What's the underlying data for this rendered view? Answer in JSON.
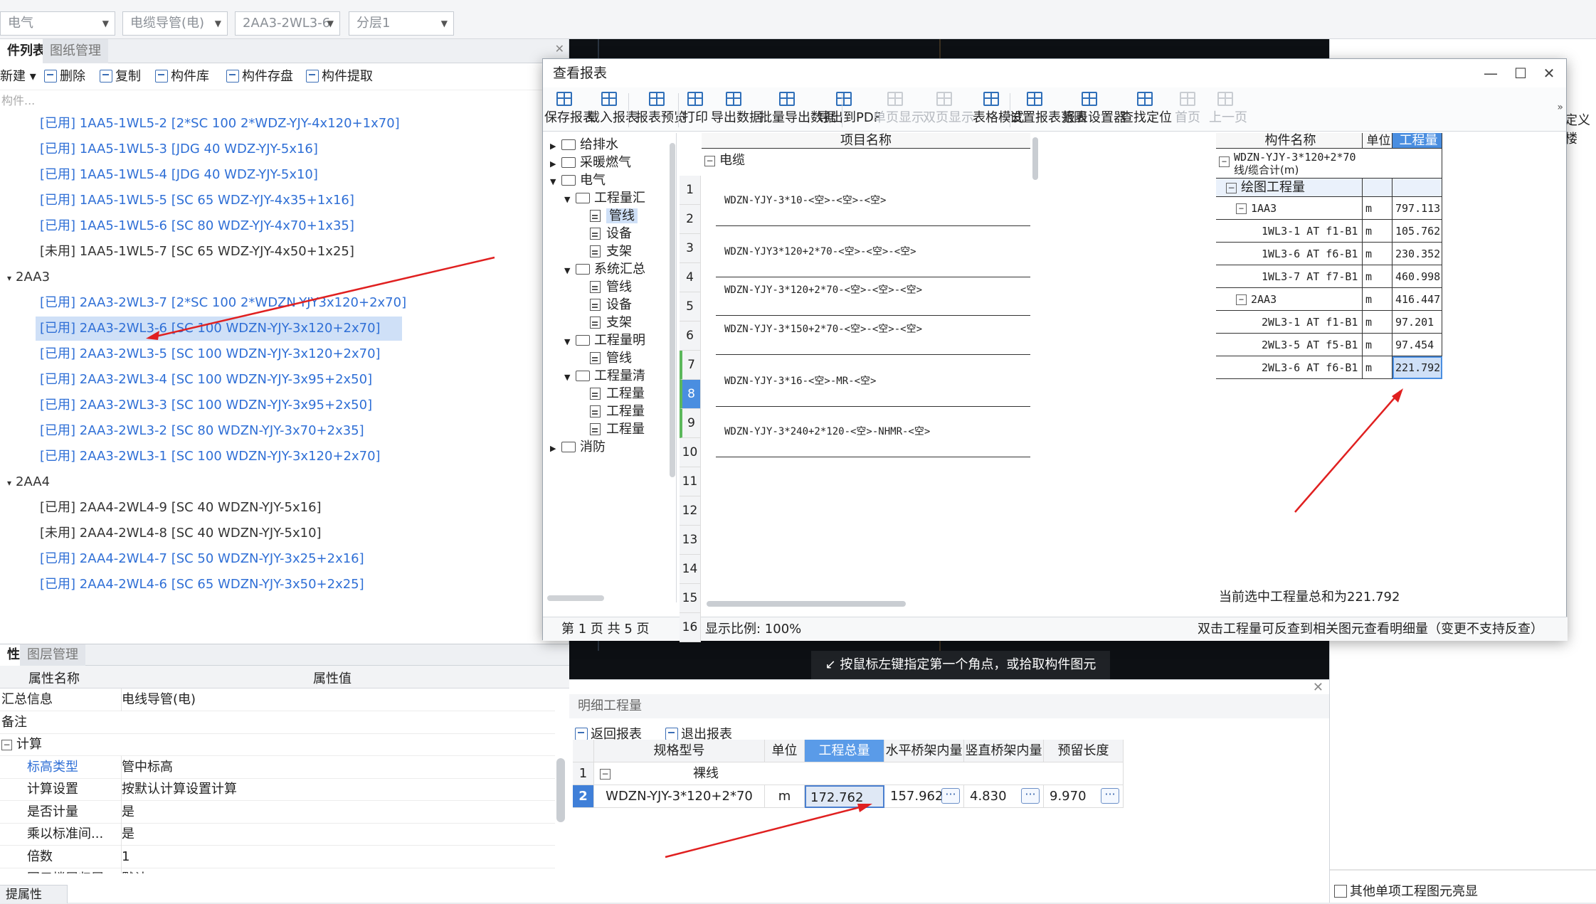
{
  "top_bar": {
    "combos": [
      "电气",
      "电缆导管(电)",
      "2AA3-2WL3-6",
      "分层1"
    ]
  },
  "left_panel": {
    "tabs": [
      "件列表",
      "图纸管理"
    ],
    "toolbar": [
      "新建",
      "删除",
      "复制",
      "构件库",
      "构件存盘",
      "构件提取"
    ],
    "filter_placeholder": "构件...",
    "items": [
      {
        "text": "[已用] 1AA5-1WL5-2 [2*SC 100 2*WDZ-YJY-4x120+1x70]",
        "type": "used"
      },
      {
        "text": "[已用] 1AA5-1WL5-3 [JDG 40 WDZ-YJY-5x16]",
        "type": "used"
      },
      {
        "text": "[已用] 1AA5-1WL5-4 [JDG 40 WDZ-YJY-5x10]",
        "type": "used"
      },
      {
        "text": "[已用] 1AA5-1WL5-5 [SC 65 WDZ-YJY-4x35+1x16]",
        "type": "used"
      },
      {
        "text": "[已用] 1AA5-1WL5-6 [SC 80 WDZ-YJY-4x70+1x35]",
        "type": "used"
      },
      {
        "text": "[未用] 1AA5-1WL5-7 [SC 65 WDZ-YJY-4x50+1x25]",
        "type": "unused"
      },
      {
        "text": "2AA3",
        "type": "group"
      },
      {
        "text": "[已用] 2AA3-2WL3-7 [2*SC 100 2*WDZN-YJY3x120+2x70]",
        "type": "used"
      },
      {
        "text": "[已用] 2AA3-2WL3-6 [SC 100 WDZN-YJY-3x120+2x70]",
        "type": "used-selected"
      },
      {
        "text": "[已用] 2AA3-2WL3-5 [SC 100 WDZN-YJY-3x120+2x70]",
        "type": "used"
      },
      {
        "text": "[已用] 2AA3-2WL3-4 [SC 100 WDZN-YJY-3x95+2x50]",
        "type": "used"
      },
      {
        "text": "[已用] 2AA3-2WL3-3 [SC 100 WDZN-YJY-3x95+2x50]",
        "type": "used"
      },
      {
        "text": "[已用] 2AA3-2WL3-2 [SC 80 WDZN-YJY-3x70+2x35]",
        "type": "used"
      },
      {
        "text": "[已用] 2AA3-2WL3-1 [SC 100 WDZN-YJY-3x120+2x70]",
        "type": "used"
      },
      {
        "text": "2AA4",
        "type": "group"
      },
      {
        "text": "[已用] 2AA4-2WL4-9 [SC 40 WDZN-YJY-5x16]",
        "type": "unused"
      },
      {
        "text": "[未用] 2AA4-2WL4-8 [SC 40 WDZN-YJY-5x10]",
        "type": "unused"
      },
      {
        "text": "[已用] 2AA4-2WL4-7 [SC 50 WDZN-YJY-3x25+2x16]",
        "type": "used"
      },
      {
        "text": "[已用] 2AA4-2WL4-6 [SC 65 WDZN-YJY-3x50+2x25]",
        "type": "used"
      }
    ]
  },
  "prop_panel": {
    "tabs": [
      "性",
      "图层管理"
    ],
    "headers": [
      "属性名称",
      "属性值"
    ],
    "rows": [
      {
        "k": "汇总信息",
        "v": "电线导管(电)"
      },
      {
        "k": "备注",
        "v": ""
      },
      {
        "k": "计算",
        "v": ""
      },
      {
        "k": "标高类型",
        "v": "管中标高"
      },
      {
        "k": "计算设置",
        "v": "按默认计算设置计算"
      },
      {
        "k": "是否计量",
        "v": "是"
      },
      {
        "k": "乘以标准间...",
        "v": "是"
      },
      {
        "k": "倍数",
        "v": "1"
      },
      {
        "k": "图元楼层归属",
        "v": "默认"
      }
    ],
    "bottom_tab": "提属性"
  },
  "cad": {
    "prompt": "按鼠标左键指定第一个角点，或拾取构件图元"
  },
  "detail": {
    "title": "明细工程量",
    "buttons": [
      "返回报表",
      "退出报表"
    ],
    "headers": [
      "规格型号",
      "单位",
      "工程总量",
      "水平桥架内量",
      "竖直桥架内量",
      "预留长度"
    ],
    "row1_label": "裸线",
    "row2": {
      "spec": "WDZN-YJY-3*120+2*70",
      "unit": "m",
      "total": "172.762",
      "h": "157.962",
      "v": "4.830",
      "r": "9.970"
    }
  },
  "right_panel": {
    "checkbox_label": "其他单项工程图元亮显",
    "edge_label": "定义楼"
  },
  "dialog": {
    "title": "查看报表",
    "ribbon": [
      "保存报表",
      "载入报表",
      "报表预览",
      "打印",
      "导出数据",
      "批量导出数据",
      "导出到PDF",
      "单页显示",
      "双页显示",
      "表格模式",
      "设置报表范围",
      "报表设置器",
      "查找定位",
      "首页",
      "上一页"
    ],
    "tree": [
      {
        "t": "给排水",
        "lvl": 0,
        "kind": "folder",
        "exp": "closed"
      },
      {
        "t": "采暖燃气",
        "lvl": 0,
        "kind": "folder",
        "exp": "closed"
      },
      {
        "t": "电气",
        "lvl": 0,
        "kind": "folder",
        "exp": "open"
      },
      {
        "t": "工程量汇",
        "lvl": 1,
        "kind": "folder",
        "exp": "open"
      },
      {
        "t": "管线",
        "lvl": 2,
        "kind": "doc",
        "sel": true
      },
      {
        "t": "设备",
        "lvl": 2,
        "kind": "doc"
      },
      {
        "t": "支架",
        "lvl": 2,
        "kind": "doc"
      },
      {
        "t": "系统汇总",
        "lvl": 1,
        "kind": "folder",
        "exp": "open"
      },
      {
        "t": "管线",
        "lvl": 2,
        "kind": "doc"
      },
      {
        "t": "设备",
        "lvl": 2,
        "kind": "doc"
      },
      {
        "t": "支架",
        "lvl": 2,
        "kind": "doc"
      },
      {
        "t": "工程量明",
        "lvl": 1,
        "kind": "folder",
        "exp": "open"
      },
      {
        "t": "管线",
        "lvl": 2,
        "kind": "doc"
      },
      {
        "t": "工程量清",
        "lvl": 1,
        "kind": "folder",
        "exp": "open"
      },
      {
        "t": "工程量",
        "lvl": 2,
        "kind": "doc"
      },
      {
        "t": "工程量",
        "lvl": 2,
        "kind": "doc"
      },
      {
        "t": "工程量",
        "lvl": 2,
        "kind": "doc"
      },
      {
        "t": "消防",
        "lvl": 0,
        "kind": "folder",
        "exp": "closed"
      }
    ],
    "row_numbers": [
      "1",
      "2",
      "3",
      "4",
      "5",
      "6",
      "7",
      "8",
      "9",
      "10",
      "11",
      "12",
      "13",
      "14",
      "15",
      "16"
    ],
    "sheet_header": "项目名称",
    "sheet_root": "电缆",
    "sheet_items": [
      "WDZN-YJY-3*10-<空>-<空>-<空>",
      "WDZN-YJY3*120+2*70-<空>-<空>-<空>",
      "WDZN-YJY-3*120+2*70-<空>-<空>-<空>",
      "WDZN-YJY-3*150+2*70-<空>-<空>-<空>",
      "WDZN-YJY-3*16-<空>-MR-<空>",
      "WDZN-YJY-3*240+2*120-<空>-NHMR-<空>"
    ],
    "qtable": {
      "h1": "构件名称",
      "h2": "单位",
      "h3": "工程量",
      "title1": "WDZN-YJY-3*120+2*70",
      "title2": "线/缆合计(m)",
      "group": "绘图工程量",
      "rows": [
        {
          "name": "1AA3",
          "unit": "m",
          "val": "797.113",
          "lvl": 1
        },
        {
          "name": "1WL3-1 AT f1-B1",
          "unit": "m",
          "val": "105.762",
          "lvl": 2
        },
        {
          "name": "1WL3-6 AT f6-B1",
          "unit": "m",
          "val": "230.352",
          "lvl": 2
        },
        {
          "name": "1WL3-7 AT f7-B1",
          "unit": "m",
          "val": "460.998",
          "lvl": 2
        },
        {
          "name": "2AA3",
          "unit": "m",
          "val": "416.447",
          "lvl": 1
        },
        {
          "name": "2WL3-1 AT f1-B1",
          "unit": "m",
          "val": "97.201",
          "lvl": 2
        },
        {
          "name": "2WL3-5 AT f5-B1",
          "unit": "m",
          "val": "97.454",
          "lvl": 2
        },
        {
          "name": "2WL3-6 AT f6-B1",
          "unit": "m",
          "val": "221.792",
          "lvl": 2,
          "sel": true
        }
      ]
    },
    "sum_text": "当前选中工程量总和为221.792",
    "status_page": "第 1 页  共 5 页",
    "status_zoom": "显示比例: 100%",
    "status_hint": "双击工程量可反查到相关图元查看明细量（变更不支持反查）"
  },
  "colors": {
    "accent": "#2f6fd6",
    "selection": "#cfe0f7",
    "arrow": "#e02020"
  }
}
